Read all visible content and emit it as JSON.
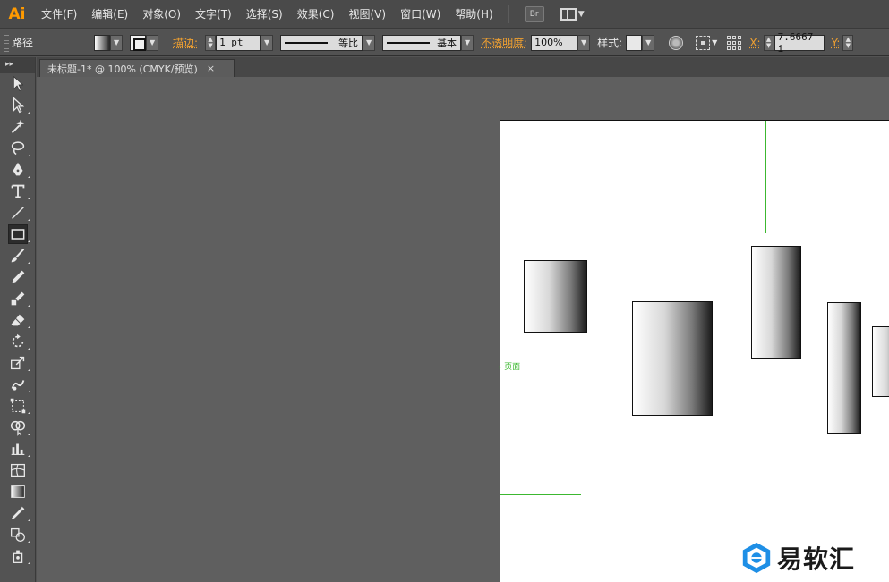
{
  "app": {
    "logo": "Ai"
  },
  "menu": {
    "items": [
      "文件(F)",
      "编辑(E)",
      "对象(O)",
      "文字(T)",
      "选择(S)",
      "效果(C)",
      "视图(V)",
      "窗口(W)",
      "帮助(H)"
    ],
    "bridge_label": "Br"
  },
  "control": {
    "selection_type": "路径",
    "stroke_label": "描边:",
    "stroke_weight": "1 pt",
    "profile_uniform": "等比",
    "brush_basic": "基本",
    "opacity_label": "不透明度:",
    "opacity_value": "100%",
    "style_label": "样式:",
    "x_label": "X:",
    "x_value": "7.6667 i",
    "y_label": "Y:"
  },
  "document": {
    "tab_title": "未标题-1* @ 100% (CMYK/预览)",
    "tab_close": "×",
    "page_label": "页面"
  },
  "tools": [
    {
      "name": "selection-tool",
      "active": false
    },
    {
      "name": "direct-selection-tool",
      "active": false
    },
    {
      "name": "magic-wand-tool",
      "active": false
    },
    {
      "name": "lasso-tool",
      "active": false
    },
    {
      "name": "pen-tool",
      "active": false
    },
    {
      "name": "type-tool",
      "active": false
    },
    {
      "name": "line-segment-tool",
      "active": false
    },
    {
      "name": "rectangle-tool",
      "active": true
    },
    {
      "name": "paintbrush-tool",
      "active": false
    },
    {
      "name": "pencil-tool",
      "active": false
    },
    {
      "name": "blob-brush-tool",
      "active": false
    },
    {
      "name": "eraser-tool",
      "active": false
    },
    {
      "name": "rotate-tool",
      "active": false
    },
    {
      "name": "scale-tool",
      "active": false
    },
    {
      "name": "warp-tool",
      "active": false
    },
    {
      "name": "free-transform-tool",
      "active": false
    },
    {
      "name": "shape-builder-tool",
      "active": false
    },
    {
      "name": "graph-tool",
      "active": false
    },
    {
      "name": "mesh-tool",
      "active": false
    },
    {
      "name": "gradient-tool",
      "active": false
    },
    {
      "name": "eyedropper-tool",
      "active": false
    },
    {
      "name": "blend-tool",
      "active": false
    },
    {
      "name": "symbol-sprayer-tool",
      "active": false
    }
  ],
  "colors": {
    "accent": "#ff9a00",
    "guide": "#3cb830",
    "label_orange": "#f0a030"
  },
  "watermark": {
    "text": "易软汇"
  }
}
